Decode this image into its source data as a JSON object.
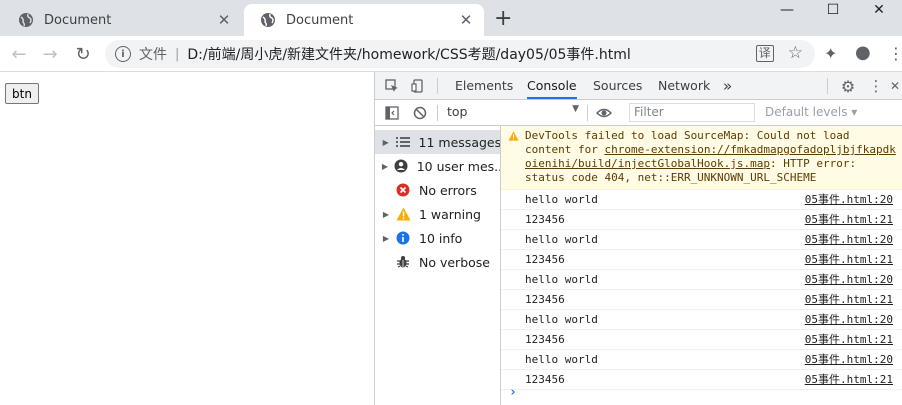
{
  "browser": {
    "tabs": [
      {
        "title": "Document",
        "close": "✕"
      },
      {
        "title": "Document",
        "close": "✕"
      }
    ],
    "new_tab": "+",
    "window": {
      "minimize": "—",
      "maximize": "☐",
      "close": "✕"
    },
    "nav": {
      "back": "←",
      "forward": "→",
      "reload": "↻"
    },
    "address": {
      "info_glyph": "i",
      "site_tag": "文件",
      "separator": "|",
      "url": "D:/前端/周小虎/新建文件夹/homework/CSS考题/day05/05事件.html"
    },
    "omnibox_icons": {
      "translate": "译",
      "star": "☆"
    },
    "extensions": {
      "puzzle": "✦",
      "profile": "●",
      "menu": "⋮"
    }
  },
  "page": {
    "button_label": "btn"
  },
  "devtools": {
    "tabs": [
      "Elements",
      "Console",
      "Sources",
      "Network"
    ],
    "more_tabs": "»",
    "settings_glyph": "⚙",
    "menu_glyph": "⋮",
    "close_glyph": "✕",
    "context": "top",
    "context_arrow": "▼",
    "filter_placeholder": "Filter",
    "levels": "Default levels ▾",
    "sidebar": [
      {
        "label": "11 messages",
        "icon": "list-icon",
        "expandable": true,
        "selected": true
      },
      {
        "label": "10 user mes...",
        "icon": "user-icon",
        "expandable": true,
        "selected": false
      },
      {
        "label": "No errors",
        "icon": "error-icon",
        "expandable": false,
        "selected": false
      },
      {
        "label": "1 warning",
        "icon": "warning-icon",
        "expandable": true,
        "selected": false
      },
      {
        "label": "10 info",
        "icon": "info-icon",
        "expandable": true,
        "selected": false
      },
      {
        "label": "No verbose",
        "icon": "bug-icon",
        "expandable": false,
        "selected": false
      }
    ],
    "warning": {
      "lines": [
        "DevTools failed to load SourceMap: Could not load",
        "content for "
      ],
      "link1": "chrome-extension://fmkadmapgofadopljbjfkapdk",
      "link2": "oienihi/build/injectGlobalHook.js.map",
      "tail": ": HTTP error:",
      "last": "status code 404, net::ERR_UNKNOWN_URL_SCHEME"
    },
    "logs": [
      {
        "message": "hello world",
        "source": "05事件.html:20"
      },
      {
        "message": "123456",
        "source": "05事件.html:21"
      },
      {
        "message": "hello world",
        "source": "05事件.html:20"
      },
      {
        "message": "123456",
        "source": "05事件.html:21"
      },
      {
        "message": "hello world",
        "source": "05事件.html:20"
      },
      {
        "message": "123456",
        "source": "05事件.html:21"
      },
      {
        "message": "hello world",
        "source": "05事件.html:20"
      },
      {
        "message": "123456",
        "source": "05事件.html:21"
      },
      {
        "message": "hello world",
        "source": "05事件.html:20"
      },
      {
        "message": "123456",
        "source": "05事件.html:21"
      }
    ],
    "prompt": "›",
    "colors": {
      "accent": "#1a73e8",
      "error": "#d93025",
      "warning": "#f9ab00",
      "info": "#1a73e8"
    }
  }
}
